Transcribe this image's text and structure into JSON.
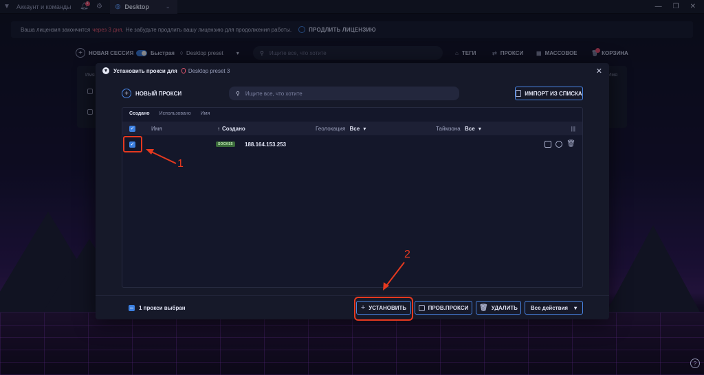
{
  "titlebar": {
    "account_label": "Аккаунт и команды",
    "notif_count": "1",
    "tab_label": "Desktop"
  },
  "license": {
    "text_before": "Ваша лицензия закончится",
    "warn": "через 3 дня.",
    "text_after": "Не забудьте продлить вашу лицензию для продолжения работы.",
    "extend_label": "ПРОДЛИТЬ ЛИЦЕНЗИЮ"
  },
  "toolbar": {
    "new_session": "НОВАЯ СЕССИЯ",
    "fast": "Быстрая",
    "preset": "Desktop preset",
    "search_placeholder": "Ищите все, что хотите",
    "tags": "ТЕГИ",
    "proxies": "ПРОКСИ",
    "bulk": "МАССОВОЕ",
    "cart": "КОРЗИНА"
  },
  "under": {
    "col_name": "Имя",
    "col_right": "Имя"
  },
  "modal": {
    "title": "Установить прокси для",
    "preset": "Desktop preset 3",
    "new_proxy": "НОВЫЙ ПРОКСИ",
    "search_placeholder": "Ищите все, что хотите",
    "import": "ИМПОРТ ИЗ СПИСКА",
    "sort_tabs": [
      "Создано",
      "Использовано",
      "Имя"
    ],
    "columns": {
      "name": "Имя",
      "created": "Создано",
      "geo": "Геолокация",
      "tz": "Таймзона",
      "all": "Все"
    },
    "rows": [
      {
        "type": "SOCKS5",
        "ip": "188.164.153.253"
      }
    ],
    "selected_info": "1 прокси выбран",
    "buttons": {
      "install": "УСТАНОВИТЬ",
      "check": "ПРОВ.ПРОКСИ",
      "delete": "УДАЛИТЬ",
      "all_actions": "Все действия"
    }
  },
  "annotations": {
    "one": "1",
    "two": "2"
  },
  "colors": {
    "accent": "#3b7fe0",
    "annotation": "#e5391f",
    "warning": "#e2556d"
  }
}
